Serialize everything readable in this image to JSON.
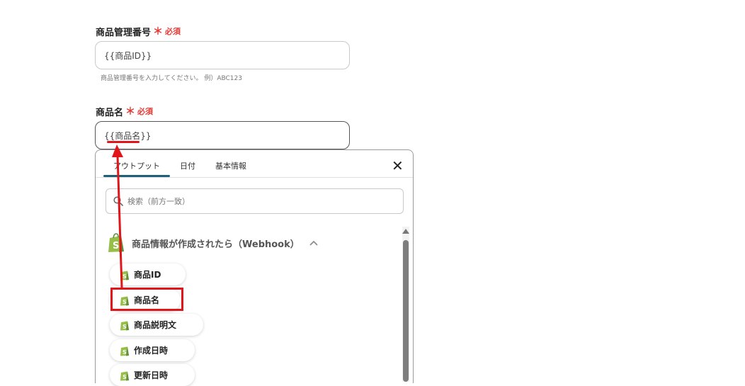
{
  "field1": {
    "label": "商品管理番号",
    "required_star": "＊",
    "required_text": "必須",
    "value": "{{商品ID}}",
    "hint": "商品管理番号を入力してください。 例）ABC123"
  },
  "field2": {
    "label": "商品名",
    "required_star": "＊",
    "required_text": "必須",
    "value": "{{商品名}}"
  },
  "panel": {
    "tabs": [
      "アウトプット",
      "日付",
      "基本情報"
    ],
    "close_label": "✕",
    "search_placeholder": "検索（前方一致）",
    "section_title": "商品情報が作成されたら（Webhook）",
    "items": [
      "商品ID",
      "商品名",
      "商品説明文",
      "作成日時",
      "更新日時"
    ]
  },
  "colors": {
    "accent_tab": "#1f5f7a",
    "required": "#e53935",
    "annotation": "#e0161b",
    "shopify_green": "#95bf47"
  },
  "icons": {
    "search": "search-icon",
    "close": "close-icon",
    "collapse": "chevron-up-icon",
    "shopify": "shopify-icon"
  }
}
